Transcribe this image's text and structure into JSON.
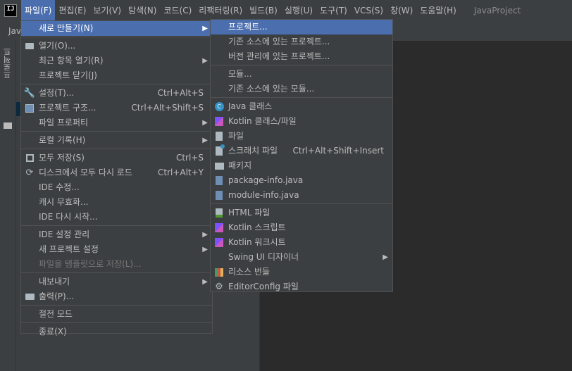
{
  "menubar": {
    "app_icon": "IJ",
    "menus": [
      "파일(F)",
      "편집(E)",
      "보기(V)",
      "탐색(N)",
      "코드(C)",
      "리팩터링(R)",
      "빌드(B)",
      "실행(U)",
      "도구(T)",
      "VCS(S)",
      "창(W)",
      "도움말(H)"
    ],
    "project_name": "JavaProject"
  },
  "toolbar": {
    "crumb": "Jav"
  },
  "left_stripe": {
    "tab_label": "프로젝트"
  },
  "file_menu": {
    "items": [
      {
        "label": "새로 만들기(N)",
        "icon": "none",
        "submenu": true,
        "selected": true
      },
      {
        "label": "열기(O)...",
        "icon": "folder-icon"
      },
      {
        "label": "최근 항목 열기(R)",
        "icon": "none",
        "submenu": true
      },
      {
        "label": "프로젝트 닫기(J)",
        "icon": "none"
      },
      {
        "label": "설정(T)...",
        "icon": "wrench-icon",
        "shortcut": "Ctrl+Alt+S"
      },
      {
        "label": "프로젝트 구조...",
        "icon": "project-structure-icon",
        "shortcut": "Ctrl+Alt+Shift+S"
      },
      {
        "label": "파일 프로퍼티",
        "icon": "none",
        "submenu": true
      },
      {
        "label": "로컬 기록(H)",
        "icon": "none",
        "submenu": true
      },
      {
        "label": "모두 저장(S)",
        "icon": "save-icon",
        "shortcut": "Ctrl+S"
      },
      {
        "label": "디스크에서 모두 다시 로드",
        "icon": "reload-icon",
        "shortcut": "Ctrl+Alt+Y"
      },
      {
        "label": "IDE 수정...",
        "icon": "none"
      },
      {
        "label": "캐시 무효화...",
        "icon": "none"
      },
      {
        "label": "IDE 다시 시작...",
        "icon": "none"
      },
      {
        "label": "IDE 설정 관리",
        "icon": "none",
        "submenu": true
      },
      {
        "label": "새 프로젝트 설정",
        "icon": "none",
        "submenu": true
      },
      {
        "label": "파일을 템플릿으로 저장(L)...",
        "icon": "none",
        "disabled": true
      },
      {
        "label": "내보내기",
        "icon": "none",
        "submenu": true
      },
      {
        "label": "출력(P)...",
        "icon": "print-icon"
      },
      {
        "label": "절전 모드",
        "icon": "none"
      },
      {
        "label": "종료(X)",
        "icon": "none"
      }
    ]
  },
  "new_submenu": {
    "items": [
      {
        "label": "프로젝트...",
        "icon": "none",
        "selected": true
      },
      {
        "label": "기존 소스에 있는 프로젝트...",
        "icon": "none"
      },
      {
        "label": "버전 관리에 있는 프로젝트...",
        "icon": "none"
      },
      {
        "label": "모듈...",
        "icon": "none"
      },
      {
        "label": "기존 소스에 있는 모듈...",
        "icon": "none"
      },
      {
        "label": "Java 클래스",
        "icon": "java-class-icon"
      },
      {
        "label": "Kotlin 클래스/파일",
        "icon": "kotlin-icon"
      },
      {
        "label": "파일",
        "icon": "file-icon"
      },
      {
        "label": "스크래치 파일",
        "icon": "scratch-file-icon",
        "shortcut": "Ctrl+Alt+Shift+Insert"
      },
      {
        "label": "패키지",
        "icon": "package-icon"
      },
      {
        "label": "package-info.java",
        "icon": "java-file-icon"
      },
      {
        "label": "module-info.java",
        "icon": "java-file-icon"
      },
      {
        "label": "HTML 파일",
        "icon": "html-file-icon"
      },
      {
        "label": "Kotlin 스크립트",
        "icon": "kotlin-icon"
      },
      {
        "label": "Kotlin 워크시트",
        "icon": "kotlin-icon"
      },
      {
        "label": "Swing UI 디자이너",
        "icon": "none",
        "submenu": true
      },
      {
        "label": "리소스 번들",
        "icon": "resource-bundle-icon"
      },
      {
        "label": "EditorConfig 파일",
        "icon": "gear-icon"
      }
    ]
  },
  "colors": {
    "menu_bg": "#3c3f41",
    "selection": "#4b6eaf",
    "editor_bg": "#2b2b2b"
  }
}
